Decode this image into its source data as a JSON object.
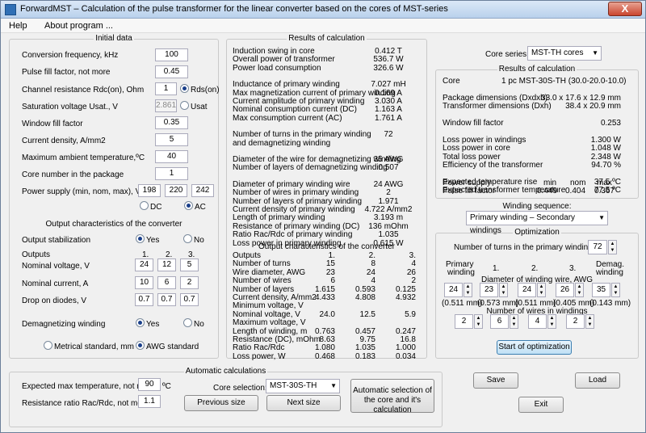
{
  "title": "ForwardMST – Calculation of the pulse transformer for the linear converter based on the cores of MST-series",
  "close_glyph": "X",
  "menu": [
    "Help",
    "About program ..."
  ],
  "initial": {
    "title": "Initial data",
    "fields": [
      {
        "label": "Conversion frequency, kHz",
        "value": "100"
      },
      {
        "label": "Pulse fill factor, not more",
        "value": "0.45"
      },
      {
        "label": "Channel resistance Rdc(on), Ohm",
        "value": "1"
      },
      {
        "label": "Saturation voltage Usat., V",
        "value": "2.861"
      },
      {
        "label": "Window fill factor",
        "value": "0.35"
      },
      {
        "label": "Current density, A/mm2",
        "value": "5"
      },
      {
        "label": "Maximum ambient temperature,ºC",
        "value": "40"
      },
      {
        "label": "Core number in the package",
        "value": "1"
      }
    ],
    "rds": "Rds(on)",
    "usat": "Usat",
    "supply_label": "Power supply (min, nom, max), V",
    "supply": [
      "198",
      "220",
      "242"
    ],
    "dc": "DC",
    "ac": "AC"
  },
  "output": {
    "title": "Output characteristics of the converter",
    "stab_label": "Output stabilization",
    "yes": "Yes",
    "no": "No",
    "outputs_label": "Outputs",
    "out_heads": [
      "1.",
      "2.",
      "3."
    ],
    "rows": [
      {
        "label": "Nominal voltage, V",
        "values": [
          "24",
          "12",
          "5"
        ]
      },
      {
        "label": "Nominal current, A",
        "values": [
          "10",
          "6",
          "2"
        ]
      },
      {
        "label": "Drop on diodes, V",
        "values": [
          "0.7",
          "0.7",
          "0.7"
        ]
      }
    ],
    "demag_label": "Demagnetizing winding",
    "metric": "Metrical standard, mm",
    "awg": "AWG standard"
  },
  "results": {
    "title": "Results of calculation",
    "groups": [
      [
        [
          "Induction swing in core",
          "0.412 T"
        ],
        [
          "Overall power of transformer",
          "536.7 W"
        ],
        [
          "Power load consumption",
          "326.6 W"
        ]
      ],
      [
        [
          "Inductance of primary winding",
          "7.027 mH"
        ],
        [
          "Max magnetization current of primary winding",
          "0.169 A"
        ],
        [
          "Current amplitude of primary winding",
          "3.030 A"
        ],
        [
          "Nominal consumption current (DC)",
          "1.163 A"
        ],
        [
          "Max consumption current (AC)",
          "1.761 A"
        ]
      ],
      [
        [
          "Number of turns in the primary winding",
          "72"
        ],
        [
          "and demagnetizing winding",
          ""
        ]
      ],
      [
        [
          "Diameter of the wire for demagnetizing winding",
          "35 AWG"
        ],
        [
          "Number of layers of demagnetizing winding",
          "0.507"
        ]
      ],
      [
        [
          "Diameter of primary winding wire",
          "24 AWG"
        ],
        [
          "Number of wires in primary winding",
          "2"
        ],
        [
          "Number of layers of primary winding",
          "1.971"
        ],
        [
          "Current density of primary winding",
          "4.722 A/mm2"
        ],
        [
          "Length of primary winding",
          "3.193 m"
        ],
        [
          "Resistance of primary winding (DC)",
          "136 mOhm"
        ],
        [
          "Ratio Rac/Rdc of primary winding",
          "1.035"
        ],
        [
          "Loss power in primary winding",
          "0.615 W"
        ]
      ]
    ],
    "oc_title": "Output characteristics of the converter",
    "oc_labels": [
      "Outputs",
      "Number of turns",
      "Wire diameter, AWG",
      "Number of wires",
      "Number of layers",
      "Current density, A/mm2",
      "Minimum voltage, V",
      "Nominal voltage, V",
      "Maximum voltage, V",
      "Length of winding, m",
      "Resistance (DC), mOhm",
      "Ratio Rac/Rdc",
      "Loss power, W"
    ],
    "oc_c1": [
      "1.",
      "15",
      "23",
      "6",
      "1.615",
      "4.433",
      "",
      "24.0",
      "",
      "0.763",
      "8.63",
      "1.080",
      "0.468"
    ],
    "oc_c2": [
      "2.",
      "8",
      "24",
      "4",
      "0.593",
      "4.808",
      "",
      "12.5",
      "",
      "0.457",
      "9.75",
      "1.035",
      "0.183"
    ],
    "oc_c3": [
      "3.",
      "4",
      "26",
      "2",
      "0.125",
      "4.932",
      "",
      "5.9",
      "",
      "0.247",
      "16.8",
      "1.000",
      "0.034"
    ]
  },
  "core": {
    "series_label": "Core series:",
    "series": "MST-TH cores",
    "res_title": "Results of calculation",
    "rows": [
      [
        "Core",
        "1 pc MST-30S-TH (30.0-20.0-10.0)"
      ],
      [
        "",
        ""
      ],
      [
        "Package dimensions (Dxdxh)",
        "33.0 x 17.6 x 12.9 mm"
      ],
      [
        "Transformer dimensions (Dxh)",
        "38.4 x 20.9 mm"
      ],
      [
        "",
        ""
      ],
      [
        "Window fill factor",
        "0.253"
      ],
      [
        "",
        ""
      ],
      [
        "Loss power in windings",
        "1.300 W"
      ],
      [
        "Loss power in core",
        "1.048 W"
      ],
      [
        "Total loss power",
        "2.348 W"
      ],
      [
        "Efficiency of the transformer",
        "94.70 %"
      ],
      [
        "",
        ""
      ],
      [
        "Expected temperature rise",
        "37.5 ºC"
      ],
      [
        "Expected transformer temperature",
        "77.5 ºC"
      ]
    ],
    "heads": [
      "min",
      "nom",
      "max"
    ],
    "supply_label": "Power supply",
    "fill_label": "Pulse fill factor",
    "fill": [
      "0.449",
      "0.404",
      "0.367"
    ]
  },
  "winding": {
    "title": "Winding sequence:",
    "value": "Primary winding – Secondary windings"
  },
  "opt": {
    "title": "Optimization",
    "turns_label": "Number of turns in the primary winding",
    "turns": "72",
    "h_primary1": "Primary",
    "h_primary2": "winding",
    "h_nums": [
      "1.",
      "2.",
      "3."
    ],
    "h_demag1": "Demag.",
    "h_demag2": "winding",
    "dia_title": "Diameter of winding wire, AWG",
    "dia": [
      "24",
      "23",
      "24",
      "26",
      "35"
    ],
    "mm": [
      "(0.511 mm)",
      "(0.573 mm)",
      "(0.511 mm)",
      "(0.405 mm)",
      "(0.143 mm)"
    ],
    "wires_title": "Number of wires in windings",
    "wires": [
      "2",
      "6",
      "4",
      "2"
    ],
    "start": "Start of optimization"
  },
  "auto": {
    "title": "Automatic calculations",
    "temp_label": "Expected max temperature, not more",
    "temp": "90",
    "temp_unit": "ºC",
    "ratio_label": "Resistance ratio Rac/Rdc, not more",
    "ratio": "1.1",
    "core_label": "Core selection:",
    "core": "MST-30S-TH",
    "prev": "Previous size",
    "next": "Next size",
    "auto_btn": "Automatic selection of the core and it's calculation"
  },
  "buttons": {
    "save": "Save",
    "load": "Load",
    "exit": "Exit"
  }
}
